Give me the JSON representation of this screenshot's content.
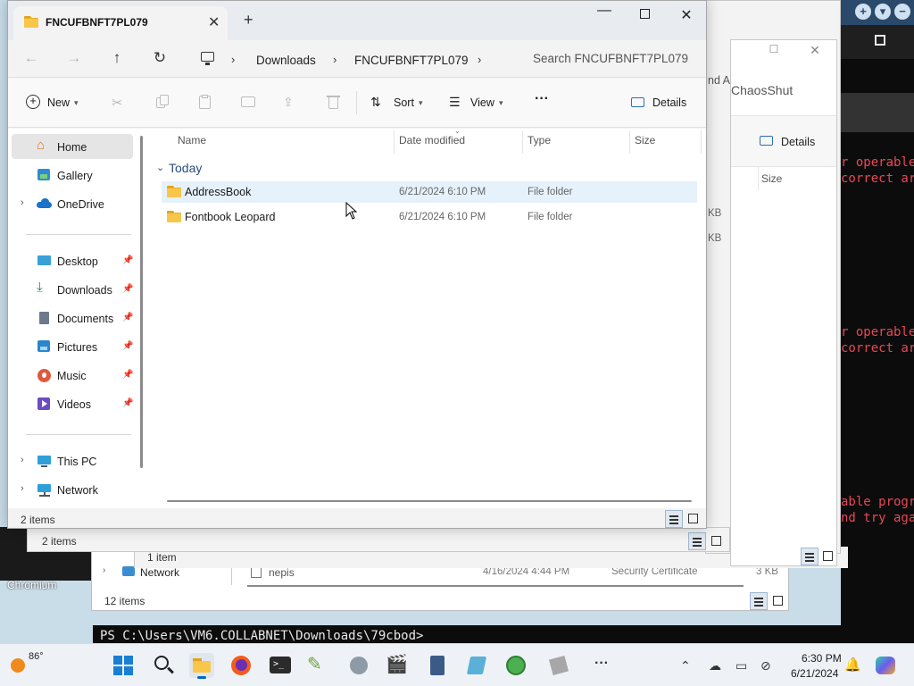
{
  "explorer": {
    "tab_title": "FNCUFBNFT7PL079",
    "breadcrumb": [
      "Downloads",
      "FNCUFBNFT7PL079"
    ],
    "search_placeholder": "Search FNCUFBNFT7PL079",
    "toolbar": {
      "new_label": "New",
      "sort_label": "Sort",
      "view_label": "View",
      "details_label": "Details",
      "more_label": "···"
    },
    "nav": {
      "items": [
        {
          "label": "Home",
          "icon": "home-icon"
        },
        {
          "label": "Gallery",
          "icon": "gallery-icon"
        },
        {
          "label": "OneDrive",
          "icon": "cloud-icon"
        },
        {
          "label": "Desktop",
          "icon": "desktop-icon"
        },
        {
          "label": "Downloads",
          "icon": "download-icon"
        },
        {
          "label": "Documents",
          "icon": "document-icon"
        },
        {
          "label": "Pictures",
          "icon": "pictures-icon"
        },
        {
          "label": "Music",
          "icon": "music-icon"
        },
        {
          "label": "Videos",
          "icon": "video-icon"
        },
        {
          "label": "This PC",
          "icon": "pc-icon"
        },
        {
          "label": "Network",
          "icon": "network-icon"
        }
      ]
    },
    "columns": [
      "Name",
      "Date modified",
      "Type",
      "Size"
    ],
    "group_label": "Today",
    "files": [
      {
        "name": "AddressBook",
        "date": "6/21/2024 6:10 PM",
        "type": "File folder"
      },
      {
        "name": "Fontbook Leopard",
        "date": "6/21/2024 6:10 PM",
        "type": "File folder"
      }
    ],
    "status": "2 items"
  },
  "background": {
    "win2_partial_title": "nd A",
    "win3_title": "ChaosShut",
    "win3_details": "Details",
    "win3_size_col": "Size",
    "kb_label_1": "KB",
    "kb_label_2": "KB",
    "win4_status": "2 items",
    "win5_status": "1 item",
    "win1": {
      "nav_label": "Network",
      "file_name": "nepis",
      "file_date": "4/16/2024 4:44 PM",
      "file_type": "Security Certificate",
      "file_size": "3 KB",
      "status": "12 items"
    },
    "terminal_errors": [
      "r operable",
      "correct ar",
      "r operable",
      "correct ar",
      "able progr",
      "nd try aga"
    ],
    "terminal_prompt": "PS C:\\Users\\VM6.COLLABNET\\Downloads\\79cbod>",
    "desktop_label": "Chromium"
  },
  "taskbar": {
    "temperature": "86°",
    "time": "6:30 PM",
    "date": "6/21/2024"
  },
  "colors": {
    "accent": "#0067c0",
    "folder": "#f8c749",
    "terminal_error": "#e74856"
  }
}
